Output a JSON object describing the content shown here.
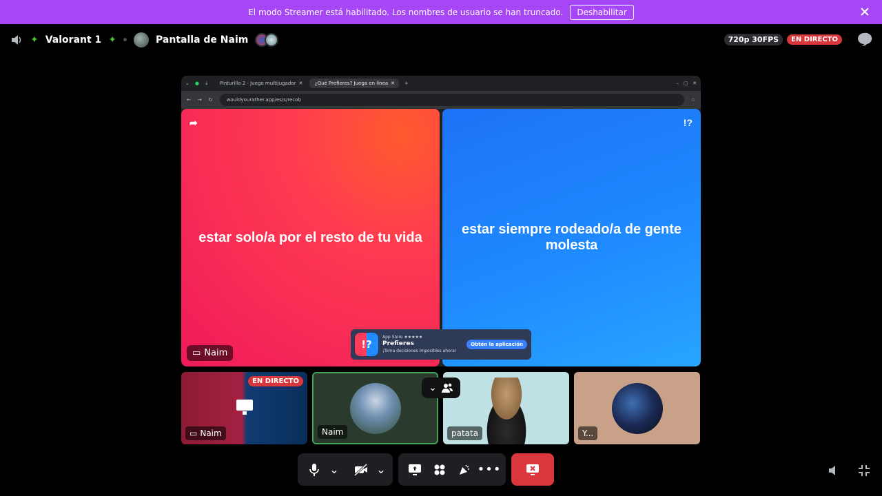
{
  "banner": {
    "message": "El modo Streamer está habilitado. Los nombres de usuario se han truncado.",
    "action_label": "Deshabilitar"
  },
  "header": {
    "channel_name": "Valorant 1",
    "stream_title": "Pantalla de Naim",
    "quality": "720p 30FPS",
    "live_label": "EN DIRECTO"
  },
  "stream": {
    "tab1": "Pinturillo 2 - Juego multijugador",
    "tab2": "¿Qué Prefieres? Juega en línea",
    "url": "wouldyourather.app/es/s/recob",
    "option_left": "estar solo/a por el resto de tu vida",
    "option_right": "estar siempre rodeado/a de gente molesta",
    "presenter": "Naim",
    "app_store": "App Store ★★★★★",
    "app_name": "Prefieres",
    "app_tagline": "¡Toma decisiones imposibles ahora!",
    "app_cta": "Obtén la aplicación"
  },
  "participants": [
    {
      "name": "Naim",
      "live_label": "EN DIRECTO"
    },
    {
      "name": "Naim"
    },
    {
      "name": "patata"
    },
    {
      "name": "Y..."
    }
  ],
  "colors": {
    "banner": "#a646f5",
    "live": "#da373c",
    "leave": "#da373c",
    "speaking_border": "#43a25a"
  }
}
